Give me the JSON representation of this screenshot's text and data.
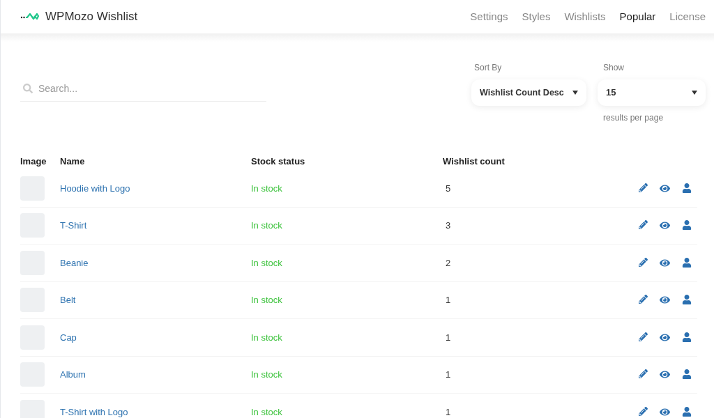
{
  "header": {
    "title": "WPMozo Wishlist",
    "nav": [
      {
        "label": "Settings",
        "selected": false
      },
      {
        "label": "Styles",
        "selected": false
      },
      {
        "label": "Wishlists",
        "selected": false
      },
      {
        "label": "Popular",
        "selected": true
      },
      {
        "label": "License",
        "selected": false
      }
    ]
  },
  "search": {
    "placeholder": "Search..."
  },
  "sort": {
    "label": "Sort By",
    "value": "Wishlist Count Desc"
  },
  "show": {
    "label": "Show",
    "value": "15",
    "hint": "results per page"
  },
  "table": {
    "columns": [
      "Image",
      "Name",
      "Stock status",
      "Wishlist count"
    ],
    "rows": [
      {
        "name": "Hoodie with Logo",
        "stock": "In stock",
        "count": "5"
      },
      {
        "name": "T-Shirt",
        "stock": "In stock",
        "count": "3"
      },
      {
        "name": "Beanie",
        "stock": "In stock",
        "count": "2"
      },
      {
        "name": "Belt",
        "stock": "In stock",
        "count": "1"
      },
      {
        "name": "Cap",
        "stock": "In stock",
        "count": "1"
      },
      {
        "name": "Album",
        "stock": "In stock",
        "count": "1"
      },
      {
        "name": "T-Shirt with Logo",
        "stock": "In stock",
        "count": "1"
      }
    ]
  }
}
